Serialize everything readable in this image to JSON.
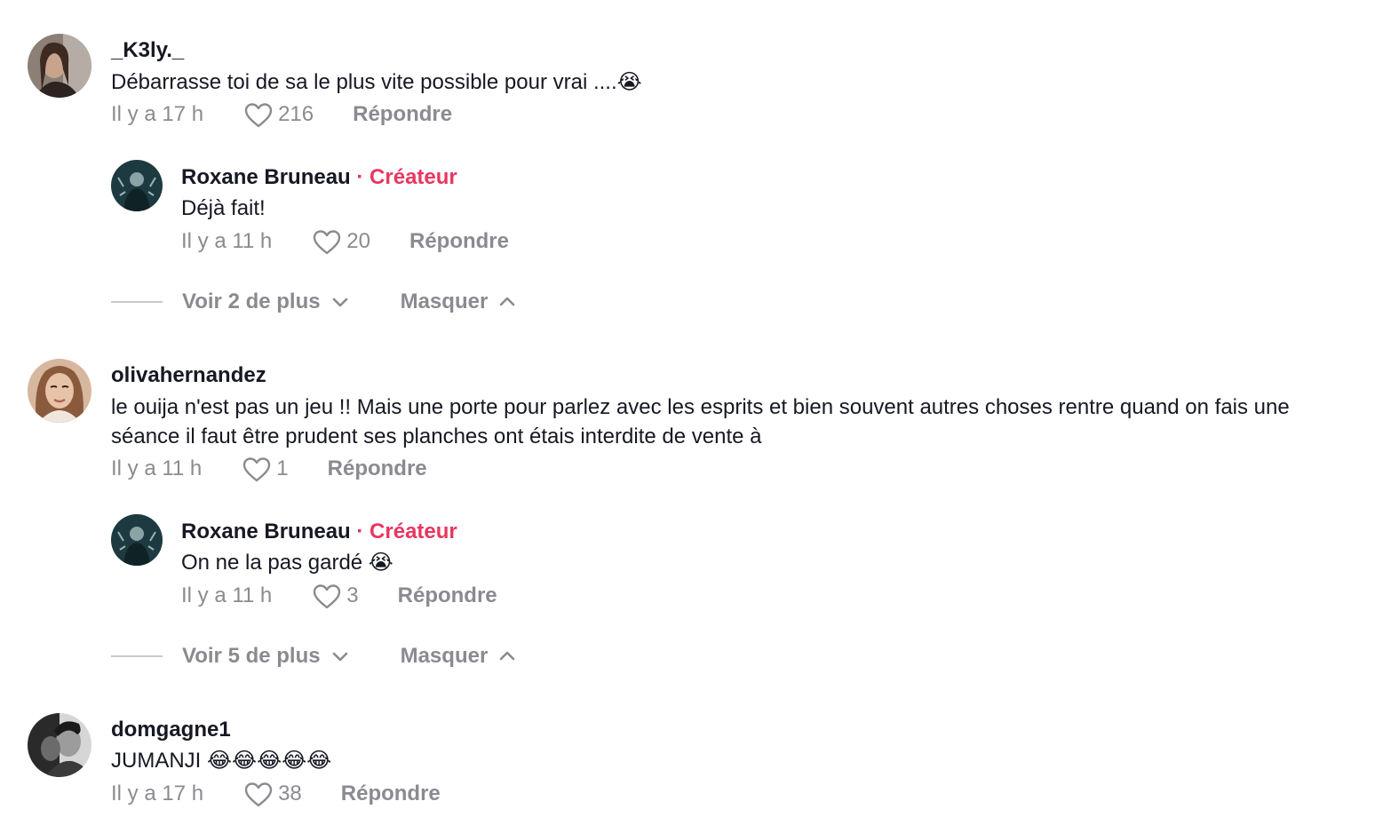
{
  "comments": [
    {
      "username": "_K3ly._",
      "text": "Débarrasse toi de sa le plus vite possible pour vrai ....😭",
      "time": "Il y a 17 h",
      "likes": "216",
      "reply_label": "Répondre",
      "reply": {
        "username": "Roxane Bruneau",
        "creator_label": "· Créateur",
        "text": "Déjà fait!",
        "time": "Il y a 11 h",
        "likes": "20",
        "reply_label": "Répondre"
      },
      "view_more_label": "Voir 2 de plus",
      "hide_label": "Masquer"
    },
    {
      "username": "olivahernandez",
      "text": "le ouija n'est pas un jeu !! Mais une porte pour parlez avec les esprits et bien souvent autres choses rentre quand on fais une séance il faut être prudent ses planches ont étais interdite de vente à",
      "time": "Il y a 11 h",
      "likes": "1",
      "reply_label": "Répondre",
      "reply": {
        "username": "Roxane Bruneau",
        "creator_label": "· Créateur",
        "text": "On ne la pas gardé 😭",
        "time": "Il y a 11 h",
        "likes": "3",
        "reply_label": "Répondre"
      },
      "view_more_label": "Voir 5 de plus",
      "hide_label": "Masquer"
    },
    {
      "username": "domgagne1",
      "text": "JUMANJI 😂😂😂😂😂",
      "time": "Il y a 17 h",
      "likes": "38",
      "reply_label": "Répondre"
    }
  ],
  "colors": {
    "creator_accent": "#e8375f",
    "meta_gray": "#8a8b91",
    "text_dark": "#161823"
  },
  "icons": {
    "like": "heart-outline-icon",
    "expand": "chevron-down-icon",
    "collapse": "chevron-up-icon"
  }
}
